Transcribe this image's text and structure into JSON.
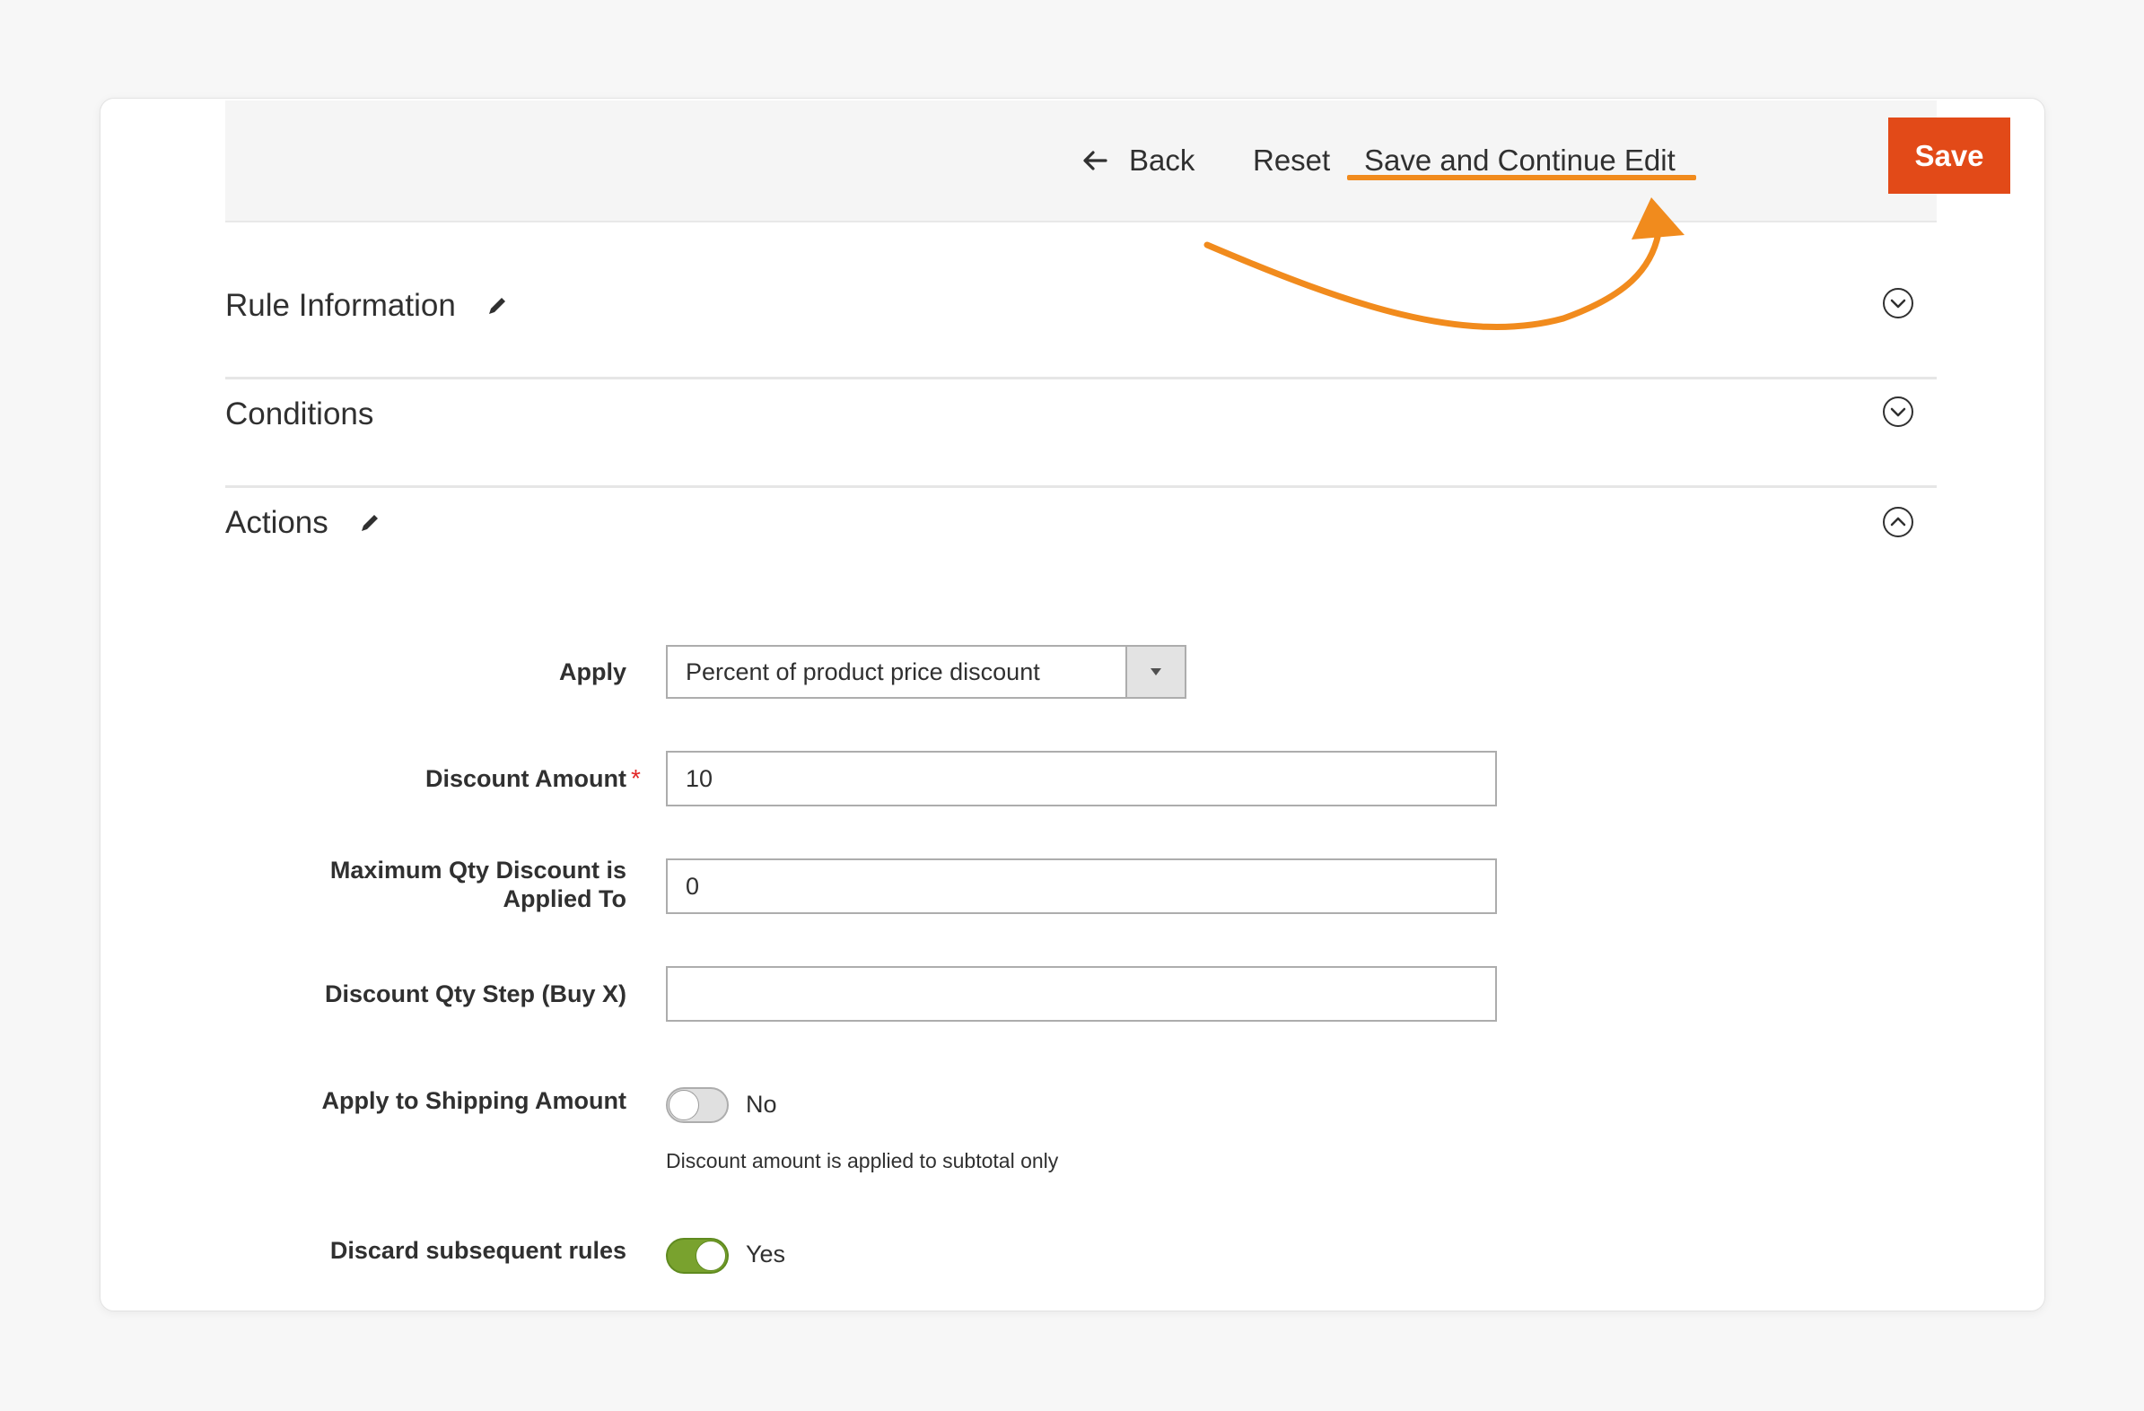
{
  "toolbar": {
    "back_label": "Back",
    "reset_label": "Reset",
    "save_continue_label": "Save and Continue Edit",
    "save_label": "Save"
  },
  "colors": {
    "save_button": "#e24a18",
    "highlight_annotation": "#f18b1d",
    "toggle_on": "#79a22e",
    "required_star": "#e22626"
  },
  "sections": [
    {
      "title": "Rule Information",
      "editable_icon": "pencil-icon",
      "state": "collapsed",
      "toggle_icon": "chevron-down-circle-icon"
    },
    {
      "title": "Conditions",
      "state": "collapsed",
      "toggle_icon": "chevron-down-circle-icon"
    },
    {
      "title": "Actions",
      "editable_icon": "pencil-icon",
      "state": "expanded",
      "toggle_icon": "chevron-up-circle-icon"
    }
  ],
  "form": {
    "apply": {
      "label": "Apply",
      "value": "Percent of product price discount"
    },
    "discount_amount": {
      "label": "Discount Amount",
      "required": "*",
      "value": "10"
    },
    "max_qty": {
      "label_line1": "Maximum Qty Discount is",
      "label_line2": "Applied To",
      "value": "0"
    },
    "qty_step": {
      "label": "Discount Qty Step (Buy X)",
      "value": ""
    },
    "apply_shipping": {
      "label": "Apply to Shipping Amount",
      "state": "No",
      "note": "Discount amount is applied to subtotal only"
    },
    "discard_rules": {
      "label": "Discard subsequent rules",
      "state": "Yes"
    }
  }
}
